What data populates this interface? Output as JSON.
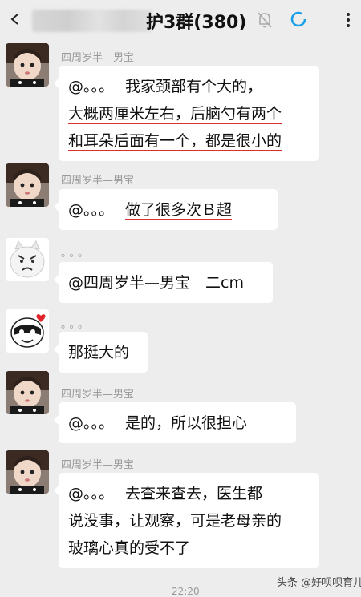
{
  "header": {
    "title_suffix": "护3群(380)"
  },
  "messages": [
    {
      "sender": "四周岁半—男宝",
      "mention": "@。。。",
      "lines": [
        "我家颈部有个大的，",
        "大概两厘米左右，后脑勺有两个",
        "和耳朵后面有一个，都是很小的"
      ]
    },
    {
      "sender": "四周岁半—男宝",
      "mention": "@。。。",
      "text": "做了很多次Ｂ超"
    },
    {
      "sender": "。。。",
      "text": "@四周岁半—男宝　二cm"
    },
    {
      "sender": "。。。",
      "text": "那挺大的"
    },
    {
      "sender": "四周岁半—男宝",
      "mention": "@。。。",
      "text": "是的，所以很担心"
    },
    {
      "sender": "四周岁半—男宝",
      "mention": "@。。。",
      "lines": [
        "去查来查去，医生都",
        "说没事，让观察，可是老母亲的",
        "玻璃心真的受不了"
      ]
    }
  ],
  "footer": {
    "watermark": "头条 @好呗呗育儿",
    "timestamp": "22:20"
  },
  "icons": {
    "back": "back-arrow-icon",
    "mute": "bell-muted-icon",
    "sync": "ring-icon",
    "more": "more-vertical-icon"
  },
  "colors": {
    "background": "#ededed",
    "bubble": "#ffffff",
    "underline": "#d9302a",
    "sync_icon": "#1aa0e8"
  }
}
